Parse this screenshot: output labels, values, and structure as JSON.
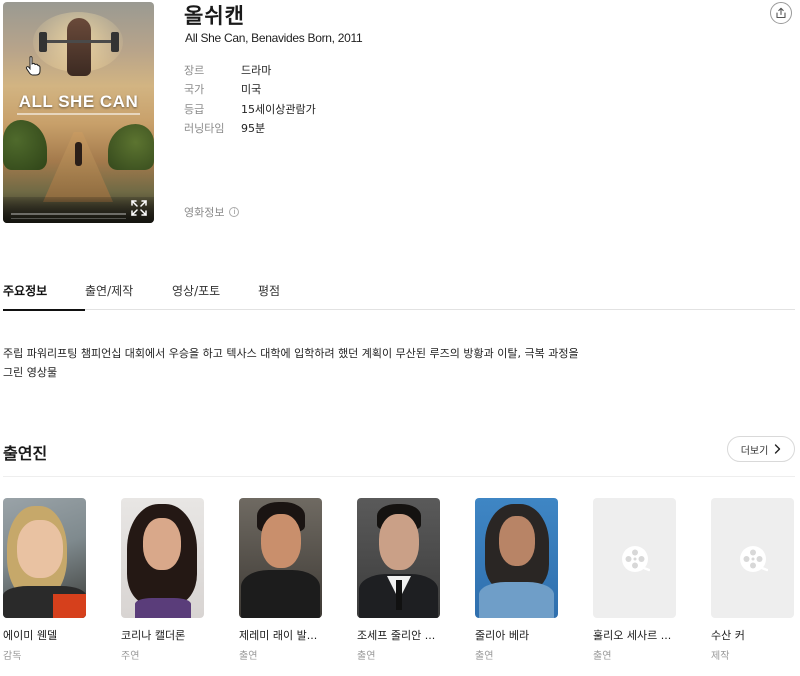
{
  "movie": {
    "title": "올쉬캔",
    "subtitle": "All She Can, Benavides Born, 2011",
    "poster_title": "ALL SHE CAN",
    "meta": [
      {
        "label": "장르",
        "value": "드라마"
      },
      {
        "label": "국가",
        "value": "미국"
      },
      {
        "label": "등급",
        "value": "15세이상관람가"
      },
      {
        "label": "러닝타임",
        "value": "95분"
      }
    ],
    "info_link": "영화정보",
    "info_icon_text": "i"
  },
  "tabs": [
    {
      "label": "주요정보",
      "active": true
    },
    {
      "label": "출연/제작",
      "active": false
    },
    {
      "label": "영상/포토",
      "active": false
    },
    {
      "label": "평점",
      "active": false
    }
  ],
  "synopsis": "주립 파워리프팅 챔피언십 대회에서 우승을 하고 텍사스 대학에 입학하려 했던 계획이 무산된 루즈의 방황과 이탈, 극복 과정을 그린 영상물",
  "cast_section": {
    "title": "출연진",
    "more_label": "더보기",
    "members": [
      {
        "name": "에이미 웬델",
        "role": "감독",
        "photo": "photo"
      },
      {
        "name": "코리나 캘더론",
        "role": "주연",
        "photo": "photo"
      },
      {
        "name": "제레미 래이 발...",
        "role": "출연",
        "photo": "photo"
      },
      {
        "name": "조세프 줄리안 ...",
        "role": "출연",
        "photo": "photo"
      },
      {
        "name": "줄리아 베라",
        "role": "출연",
        "photo": "photo"
      },
      {
        "name": "훌리오 세사르 ...",
        "role": "출연",
        "photo": "film-reel-placeholder-icon"
      },
      {
        "name": "수산 커",
        "role": "제작",
        "photo": "film-reel-placeholder-icon"
      }
    ]
  },
  "colors": {
    "text": "#1a1a1a",
    "muted": "#8a8a8a",
    "divider": "#e2e2e2",
    "placeholder_bg": "#eeeeee"
  }
}
